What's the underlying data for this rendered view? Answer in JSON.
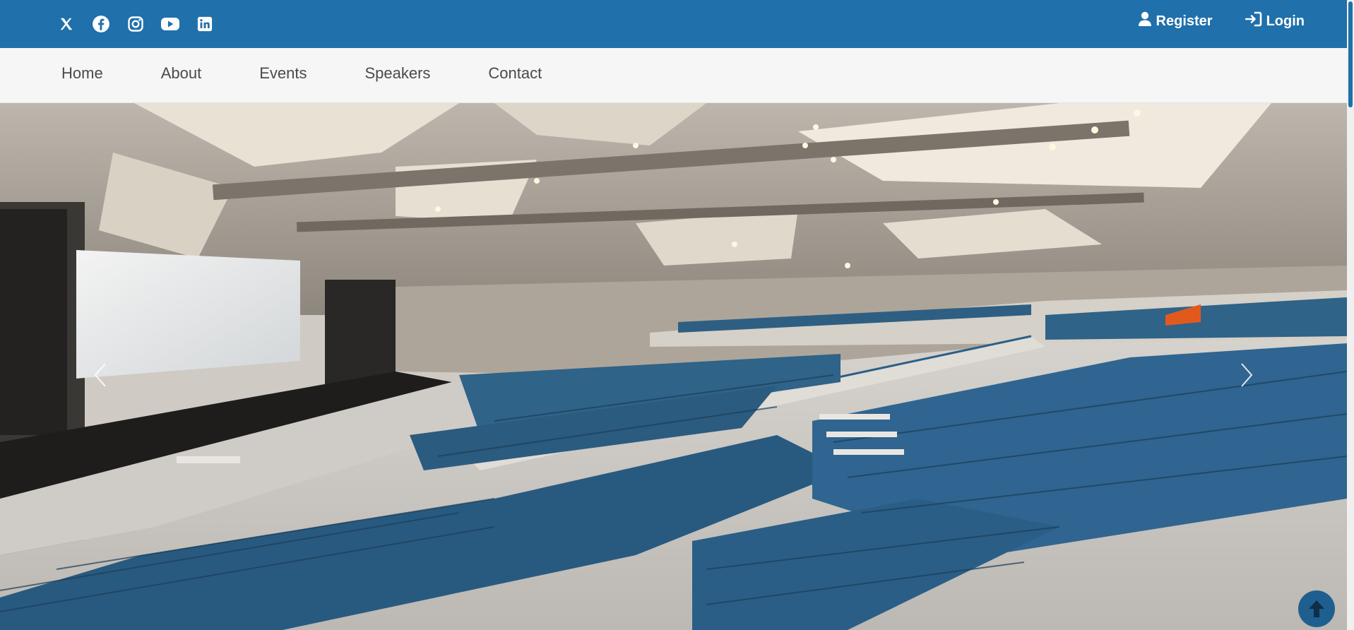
{
  "topbar": {
    "background_color": "#1f70ab",
    "social_icons": [
      "x-icon",
      "facebook-icon",
      "instagram-icon",
      "youtube-icon",
      "linkedin-icon"
    ],
    "register_label": "Register",
    "login_label": "Login"
  },
  "nav": {
    "items": [
      "Home",
      "About",
      "Events",
      "Speakers",
      "Contact"
    ]
  },
  "hero": {
    "image": "auditorium photo with blue seats",
    "prev_icon": "chevron-left-icon",
    "next_icon": "chevron-right-icon"
  },
  "back_to_top": {
    "icon": "arrow-up-icon"
  }
}
